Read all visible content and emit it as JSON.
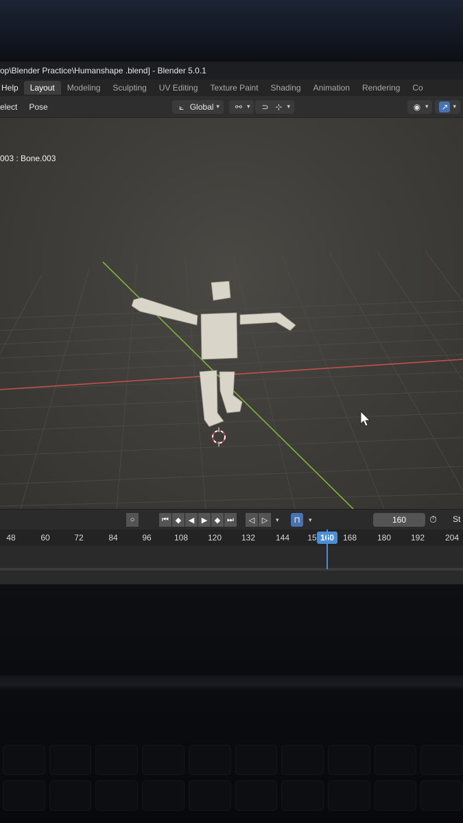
{
  "window": {
    "title": "op\\Blender Practice\\Humanshape .blend] - Blender 5.0.1"
  },
  "menu": {
    "help": "Help"
  },
  "workspaces": [
    "Layout",
    "Modeling",
    "Sculpting",
    "UV Editing",
    "Texture Paint",
    "Shading",
    "Animation",
    "Rendering",
    "Co"
  ],
  "active_workspace": "Layout",
  "header": {
    "select": "elect",
    "pose": "Pose",
    "orientation": "Global"
  },
  "viewport": {
    "active_bone": "003 : Bone.003"
  },
  "timeline": {
    "current_frame": "160",
    "start_label": "St",
    "ticks": [
      "48",
      "60",
      "72",
      "84",
      "96",
      "108",
      "120",
      "132",
      "144",
      "15",
      "168",
      "180",
      "192",
      "204"
    ]
  },
  "icons": [
    "pivot-icon",
    "orientation-icon",
    "snap-icon",
    "proportional-icon",
    "visibility-icon",
    "gizmo-icon",
    "record-icon",
    "jump-start-icon",
    "prev-keyframe-icon",
    "play-reverse-icon",
    "play-icon",
    "next-keyframe-icon",
    "jump-end-icon",
    "keying-icon",
    "stopwatch-icon",
    "mouse-cursor-icon",
    "3d-cursor-icon"
  ],
  "colors": {
    "accent": "#4a8ed8",
    "x_axis": "#c0504d",
    "y_axis": "#7fb537",
    "active_tab": "#3d3d3d"
  }
}
